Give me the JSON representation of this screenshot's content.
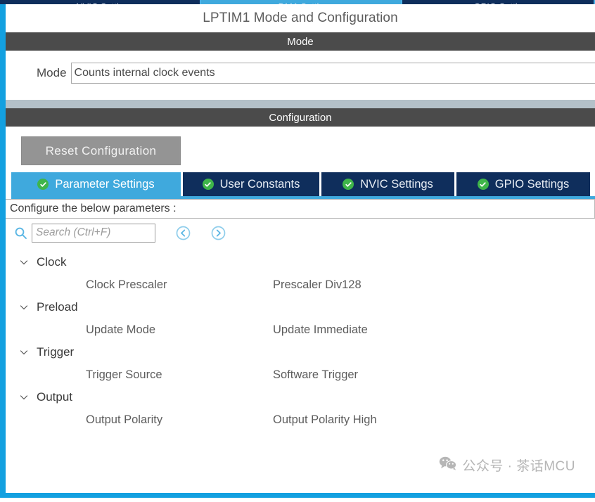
{
  "background_tabs": [
    {
      "label": "NVIC Settings",
      "active": false
    },
    {
      "label": "DMA Settings",
      "active": true
    },
    {
      "label": "GPIO Settings",
      "active": false
    }
  ],
  "panel": {
    "title": "LPTIM1 Mode and Configuration",
    "mode_section": {
      "header": "Mode",
      "mode_label": "Mode",
      "mode_value": "Counts internal clock events"
    },
    "configuration_section": {
      "header": "Configuration",
      "reset_button": "Reset Configuration"
    },
    "tabs": [
      {
        "label": "Parameter Settings",
        "active": true,
        "icon": "green-check-icon"
      },
      {
        "label": "User Constants",
        "active": false,
        "icon": "green-check-icon"
      },
      {
        "label": "NVIC Settings",
        "active": false,
        "icon": "green-check-icon"
      },
      {
        "label": "GPIO Settings",
        "active": false,
        "icon": "green-check-icon"
      }
    ],
    "configure_hint": "Configure the below parameters :",
    "search": {
      "icon": "search-icon",
      "placeholder": "Search (Ctrl+F)",
      "value": "",
      "prev_icon": "chevron-left-circle-icon",
      "next_icon": "chevron-right-circle-icon"
    },
    "parameter_groups": [
      {
        "name": "Clock",
        "expanded": true,
        "items": [
          {
            "name": "Clock Prescaler",
            "value": "Prescaler Div128"
          }
        ]
      },
      {
        "name": "Preload",
        "expanded": true,
        "items": [
          {
            "name": "Update Mode",
            "value": "Update Immediate"
          }
        ]
      },
      {
        "name": "Trigger",
        "expanded": true,
        "items": [
          {
            "name": "Trigger Source",
            "value": "Software Trigger"
          }
        ]
      },
      {
        "name": "Output",
        "expanded": true,
        "items": [
          {
            "name": "Output Polarity",
            "value": "Output Polarity High"
          }
        ]
      }
    ]
  },
  "watermark": {
    "icon": "wechat-icon",
    "text": "公众号 · 茶话MCU"
  },
  "colors": {
    "accent_blue": "#13a0e0",
    "tab_active": "#3fa9dd",
    "tab_inactive": "#0f2e5c",
    "section_bar": "#4b4b4b",
    "check_green": "#3fb54a",
    "button_grey": "#949494"
  }
}
